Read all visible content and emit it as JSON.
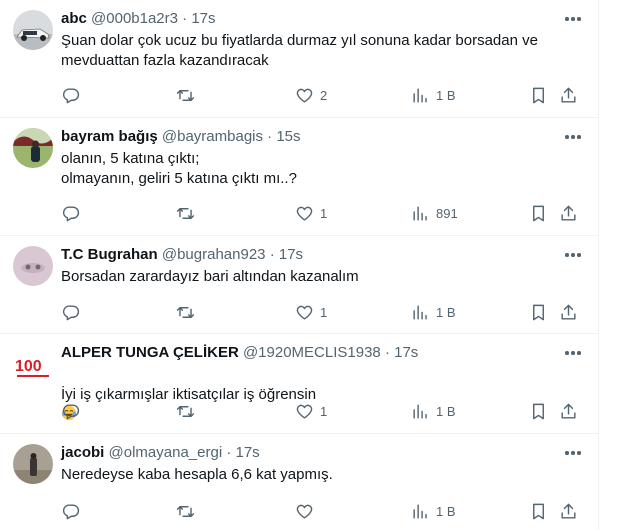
{
  "tweets": [
    {
      "name": "abc",
      "handle": "@000b1a2r3",
      "dot": "·",
      "time": "17s",
      "text": "Şuan dolar çok ucuz bu fiyatlarda durmaz yıl sonuna kadar borsadan ve mevduattan fazla kazandıracak",
      "reply_count": "",
      "retweet_count": "",
      "like_count": "2",
      "view_count": "1 B"
    },
    {
      "name": "bayram bağış",
      "handle": "@bayrambagis",
      "dot": "·",
      "time": "15s",
      "text": "olanın, 5 katına çıktı;\nolmayanın, geliri 5 katına çıktı mı..?",
      "reply_count": "",
      "retweet_count": "",
      "like_count": "1",
      "view_count": "891"
    },
    {
      "name": "T.C Bugrahan",
      "handle": "@bugrahan923",
      "dot": "·",
      "time": "17s",
      "text": "Borsadan zarardayız bari altından kazanalım",
      "reply_count": "",
      "retweet_count": "",
      "like_count": "1",
      "view_count": "1 B"
    },
    {
      "name": "ALPER TUNGA ÇELİKER",
      "handle": "@1920MECLIS1938",
      "dot": "·",
      "time": "17s",
      "text": "İyi iş çıkarmışlar iktisatçılar iş öğrensin",
      "reply_count": "",
      "retweet_count": "",
      "like_count": "1",
      "view_count": "1 B"
    },
    {
      "name": "jacobi",
      "handle": "@olmayana_ergi",
      "dot": "·",
      "time": "17s",
      "text": "Neredeyse kaba hesapla 6,6 kat yapmış.",
      "reply_count": "",
      "retweet_count": "",
      "like_count": "",
      "view_count": "1 B"
    }
  ],
  "icons": {
    "reply": "reply-icon",
    "retweet": "retweet-icon",
    "like": "heart-icon",
    "views": "views-icon",
    "bookmark": "bookmark-icon",
    "share": "share-icon",
    "more": "more-icon",
    "emoji": "joy-emoji"
  },
  "logo_text": "100",
  "colors": {
    "muted": "#536471",
    "text": "#0f1419",
    "border": "#eff3f4"
  }
}
